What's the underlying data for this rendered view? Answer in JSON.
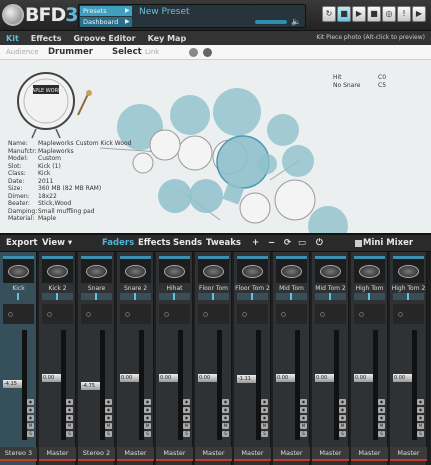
{
  "app": {
    "logo": "BFD",
    "logo_version": "3",
    "presets_label": "Presets",
    "dashboard_label": "Dashboard",
    "preset_name": "New Preset",
    "transport": [
      "↻",
      "■",
      "▶",
      "■",
      "◎",
      "!",
      "▶"
    ]
  },
  "menu": {
    "items": [
      "Kit",
      "Effects",
      "Groove Editor",
      "Key Map"
    ],
    "active": "Kit",
    "hint": "Kit Piece photo (Alt-click to preview)"
  },
  "kit": {
    "audience_label": "Audience",
    "drummer_label": "Drummer",
    "select_label": "Select",
    "link_label": "Link",
    "info": [
      {
        "k": "Name:",
        "v": "Mapleworks Custom Kick Wood"
      },
      {
        "k": "Manufctr:",
        "v": "Mapleworks"
      },
      {
        "k": "Model:",
        "v": "Custom"
      },
      {
        "k": "Slot:",
        "v": "Kick (1)"
      },
      {
        "k": "Class:",
        "v": "Kick"
      },
      {
        "k": "Date:",
        "v": "2011"
      },
      {
        "k": "Size:",
        "v": "360 MB (82 MB RAM)"
      },
      {
        "k": "Dimen:",
        "v": "18x22"
      },
      {
        "k": "Beater:",
        "v": "Stick,Wood"
      },
      {
        "k": "Damping:",
        "v": "Small muffling pad"
      },
      {
        "k": "Material:",
        "v": "Maple"
      }
    ],
    "hits": [
      {
        "k": "Hit",
        "v": "C0"
      },
      {
        "k": "No Snare",
        "v": "C5"
      }
    ]
  },
  "mixer": {
    "export_label": "Export",
    "view_label": "View ▾",
    "tabs": [
      "Faders",
      "Effects",
      "Sends",
      "Tweaks"
    ],
    "active_tab": "Faders",
    "icons": [
      "+",
      "−",
      "⟳",
      "▭",
      "⏻"
    ],
    "mini_mixer_label": "Mini Mixer",
    "channels": [
      {
        "name": "Kick",
        "gain": "-4.15",
        "fader": 0.55,
        "output": "Stereo 3"
      },
      {
        "name": "Kick 2",
        "gain": "0.00",
        "fader": 0.6,
        "output": "Master"
      },
      {
        "name": "Snare",
        "gain": "-4.75",
        "fader": 0.53,
        "output": "Stereo 2"
      },
      {
        "name": "Snare 2",
        "gain": "0.00",
        "fader": 0.6,
        "output": "Master"
      },
      {
        "name": "Hihat",
        "gain": "0.00",
        "fader": 0.6,
        "output": "Master"
      },
      {
        "name": "Floor Tom",
        "gain": "0.00",
        "fader": 0.6,
        "output": "Master"
      },
      {
        "name": "Floor Tom 2",
        "gain": "-1.11",
        "fader": 0.59,
        "output": "Master"
      },
      {
        "name": "Mid Tom",
        "gain": "0.00",
        "fader": 0.6,
        "output": "Master"
      },
      {
        "name": "Mid Tom 2",
        "gain": "0.00",
        "fader": 0.6,
        "output": "Master"
      },
      {
        "name": "High Tom",
        "gain": "0.00",
        "fader": 0.6,
        "output": "Master"
      },
      {
        "name": "High Tom 2",
        "gain": "0.00",
        "fader": 0.6,
        "output": "Master"
      }
    ],
    "channel_buttons": [
      "◉",
      "◉",
      "◉",
      "M",
      "S"
    ]
  },
  "colors": {
    "accent": "#4fb4d8",
    "pad": "#8fc1cc"
  }
}
